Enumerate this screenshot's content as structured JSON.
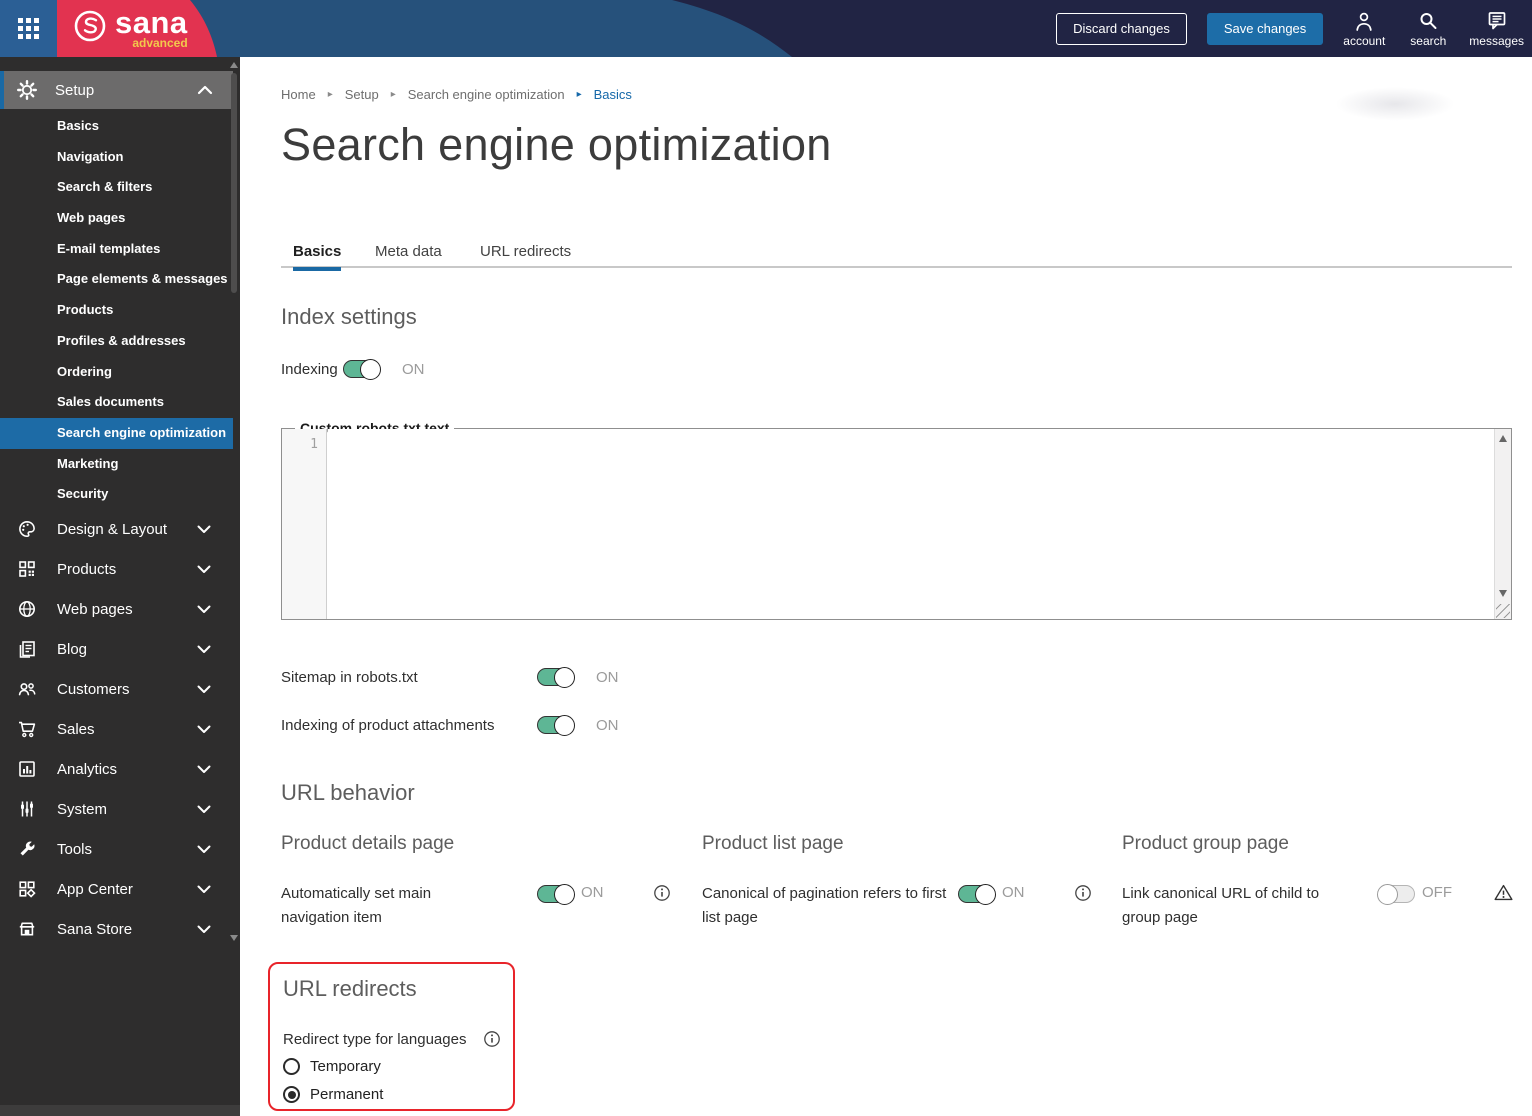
{
  "header": {
    "brand": {
      "name": "sana",
      "tagline": "advanced"
    },
    "discard_label": "Discard changes",
    "save_label": "Save changes",
    "nav_icons": [
      {
        "label": "account",
        "icon": "account-icon"
      },
      {
        "label": "search",
        "icon": "search-icon"
      },
      {
        "label": "messages",
        "icon": "messages-icon"
      }
    ]
  },
  "sidebar": {
    "setup": {
      "label": "Setup",
      "items": [
        "Basics",
        "Navigation",
        "Search & filters",
        "Web pages",
        "E-mail templates",
        "Page elements & messages",
        "Products",
        "Profiles & addresses",
        "Ordering",
        "Sales documents",
        "Search engine optimization",
        "Marketing",
        "Security"
      ],
      "selected_item": "Search engine optimization"
    },
    "sections": [
      {
        "label": "Design & Layout",
        "icon": "palette-icon"
      },
      {
        "label": "Products",
        "icon": "product-grid-icon"
      },
      {
        "label": "Web pages",
        "icon": "globe-icon"
      },
      {
        "label": "Blog",
        "icon": "blog-icon"
      },
      {
        "label": "Customers",
        "icon": "customers-icon"
      },
      {
        "label": "Sales",
        "icon": "cart-icon"
      },
      {
        "label": "Analytics",
        "icon": "analytics-icon"
      },
      {
        "label": "System",
        "icon": "sliders-icon"
      },
      {
        "label": "Tools",
        "icon": "wrench-icon"
      },
      {
        "label": "App Center",
        "icon": "app-center-icon"
      },
      {
        "label": "Sana Store",
        "icon": "store-icon"
      }
    ]
  },
  "breadcrumb": [
    "Home",
    "Setup",
    "Search engine optimization",
    "Basics"
  ],
  "page": {
    "title": "Search engine optimization"
  },
  "tabs": [
    {
      "label": "Basics",
      "active": true
    },
    {
      "label": "Meta data",
      "active": false
    },
    {
      "label": "URL redirects",
      "active": false
    }
  ],
  "index_settings": {
    "heading": "Index settings",
    "indexing_label": "Indexing",
    "indexing_state": "ON",
    "robots_legend": "Custom robots.txt text",
    "robots_line_number": "1",
    "robots_value": "",
    "sitemap_label": "Sitemap in robots.txt",
    "sitemap_state": "ON",
    "attachments_label": "Indexing of product attachments",
    "attachments_state": "ON"
  },
  "url_behavior": {
    "heading": "URL behavior",
    "columns": [
      {
        "heading": "Product details page",
        "setting": "Automatically set main navigation item",
        "state": "ON",
        "trailing_icon": "info-icon"
      },
      {
        "heading": "Product list page",
        "setting": "Canonical of pagination refers to first list page",
        "state": "ON",
        "trailing_icon": "info-icon"
      },
      {
        "heading": "Product group page",
        "setting": "Link canonical URL of child to group page",
        "state": "OFF",
        "trailing_icon": "warning-icon"
      }
    ]
  },
  "url_redirects": {
    "heading": "URL redirects",
    "label": "Redirect type for languages",
    "options": [
      {
        "label": "Temporary",
        "selected": false
      },
      {
        "label": "Permanent",
        "selected": true
      }
    ]
  },
  "colors": {
    "header_navy": "#212444",
    "header_band_blue": "#26517b",
    "brand_red": "#e23350",
    "brand_gold": "#f2c84c",
    "app_tile_blue": "#2b5f95",
    "save_button_blue": "#1d6da8",
    "sidebar_bg": "#2e2d2d",
    "sidebar_selected_blue": "#1d6ba6",
    "accent_blue": "#1a69a4",
    "toggle_green": "#5eb695",
    "highlight_red": "#e8242a"
  }
}
